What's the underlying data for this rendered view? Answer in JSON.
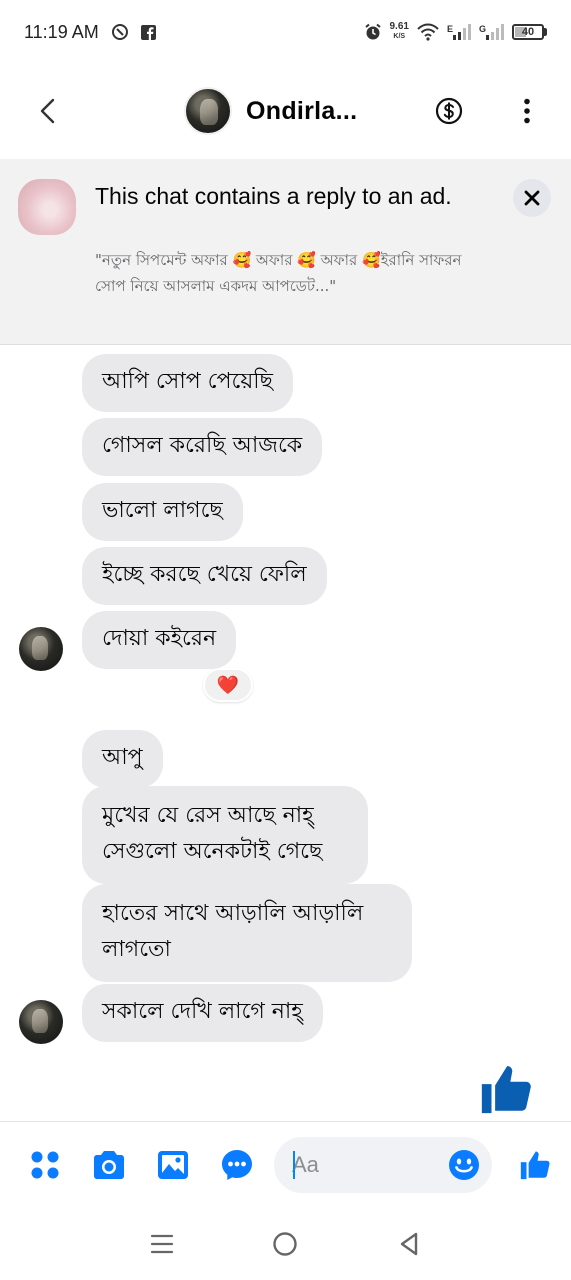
{
  "status_bar": {
    "time": "11:19 AM",
    "net_speed_value": "9.61",
    "net_speed_unit": "K/S",
    "sim1_label": "E",
    "sim2_label": "G",
    "battery_level": "40"
  },
  "header": {
    "contact_name": "Ondirla...",
    "icons": [
      "back-chevron-icon",
      "dollar-circle-icon",
      "more-vertical-icon"
    ]
  },
  "ad_banner": {
    "title": "This chat contains a reply to an ad.",
    "quote": "\"নতুন সিপমেন্ট অফার 🥰 অফার 🥰 অফার 🥰ইরানি সাফরন সোপ নিয়ে আসলাম একদম আপডেট...\""
  },
  "messages": [
    {
      "text": "আপি সোপ পেয়েছি"
    },
    {
      "text": "গোসল করেছি আজকে"
    },
    {
      "text": "ভালো লাগছে"
    },
    {
      "text": "ইচ্ছে করছে খেয়ে ফেলি"
    },
    {
      "text": "দোয়া কইরেন",
      "reaction": "❤️"
    },
    {
      "text": "আপু"
    },
    {
      "text": "মুখের যে রেস আছে নাহ্ সেগুলো অনেকটাই গেছে"
    },
    {
      "text": "হাতের সাথে আড়ালি আড়ালি লাগতো"
    },
    {
      "text": "সকালে দেখি লাগে নাহ্"
    }
  ],
  "composer": {
    "placeholder": "Aa",
    "icons": [
      "apps-grid-icon",
      "camera-icon",
      "gallery-icon",
      "messenger-chat-icon",
      "emoji-icon",
      "thumbs-up-icon"
    ]
  },
  "nav": {
    "icons": [
      "recents-icon",
      "home-icon",
      "back-icon"
    ]
  },
  "colors": {
    "accent": "#0084ff",
    "big_like": "#0a5fb3",
    "bubble": "#e9e9eb",
    "banner_bg": "#f2f2f2"
  }
}
